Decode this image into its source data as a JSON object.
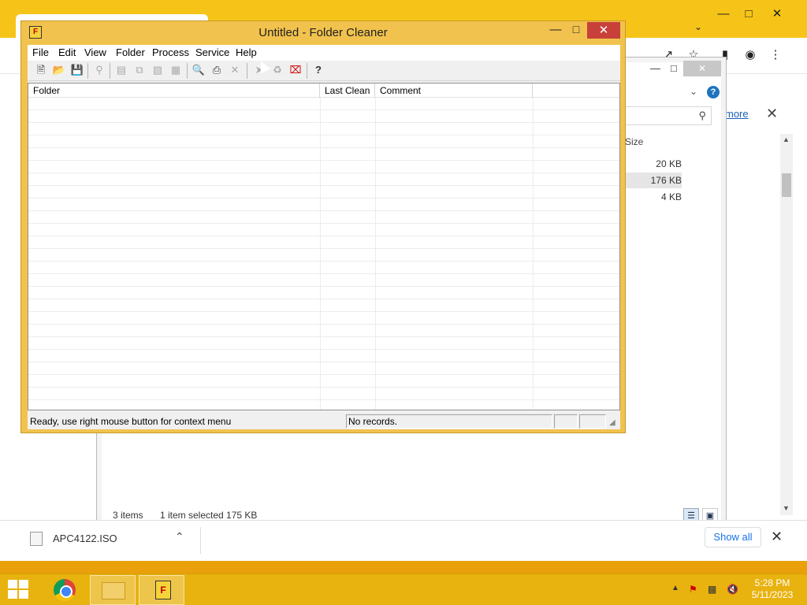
{
  "browser": {
    "info_link": "more",
    "download_shelf": {
      "file_name": "APC4122.ISO",
      "show_all_label": "Show all"
    }
  },
  "explorer": {
    "size_header": "Size",
    "sizes": [
      "20 KB",
      "176 KB",
      "4 KB"
    ],
    "status_items": "3 items",
    "status_selected": "1 item selected  175 KB"
  },
  "folder_cleaner": {
    "title": "Untitled - Folder Cleaner",
    "menu": [
      "File",
      "Edit",
      "View",
      "Folder",
      "Process",
      "Service",
      "Help"
    ],
    "toolbar_icons": [
      "new-icon",
      "open-icon",
      "save-icon",
      "find-icon",
      "properties-icon",
      "copy-icon",
      "paste-icon",
      "report-icon",
      "preview-icon",
      "print-icon",
      "delete-icon",
      "pointer-icon",
      "recycle-icon",
      "stop-icon",
      "help-icon"
    ],
    "columns": [
      "Folder",
      "Last Clean",
      "Comment"
    ],
    "status_left": "Ready, use right mouse button for context menu",
    "status_records": "No records."
  },
  "taskbar": {
    "time": "5:28 PM",
    "date": "5/11/2023"
  },
  "colors": {
    "wallpaper": "#f5c518",
    "window_frame": "#f1c24d",
    "close_button": "#c7413a",
    "link": "#1a73e8"
  }
}
